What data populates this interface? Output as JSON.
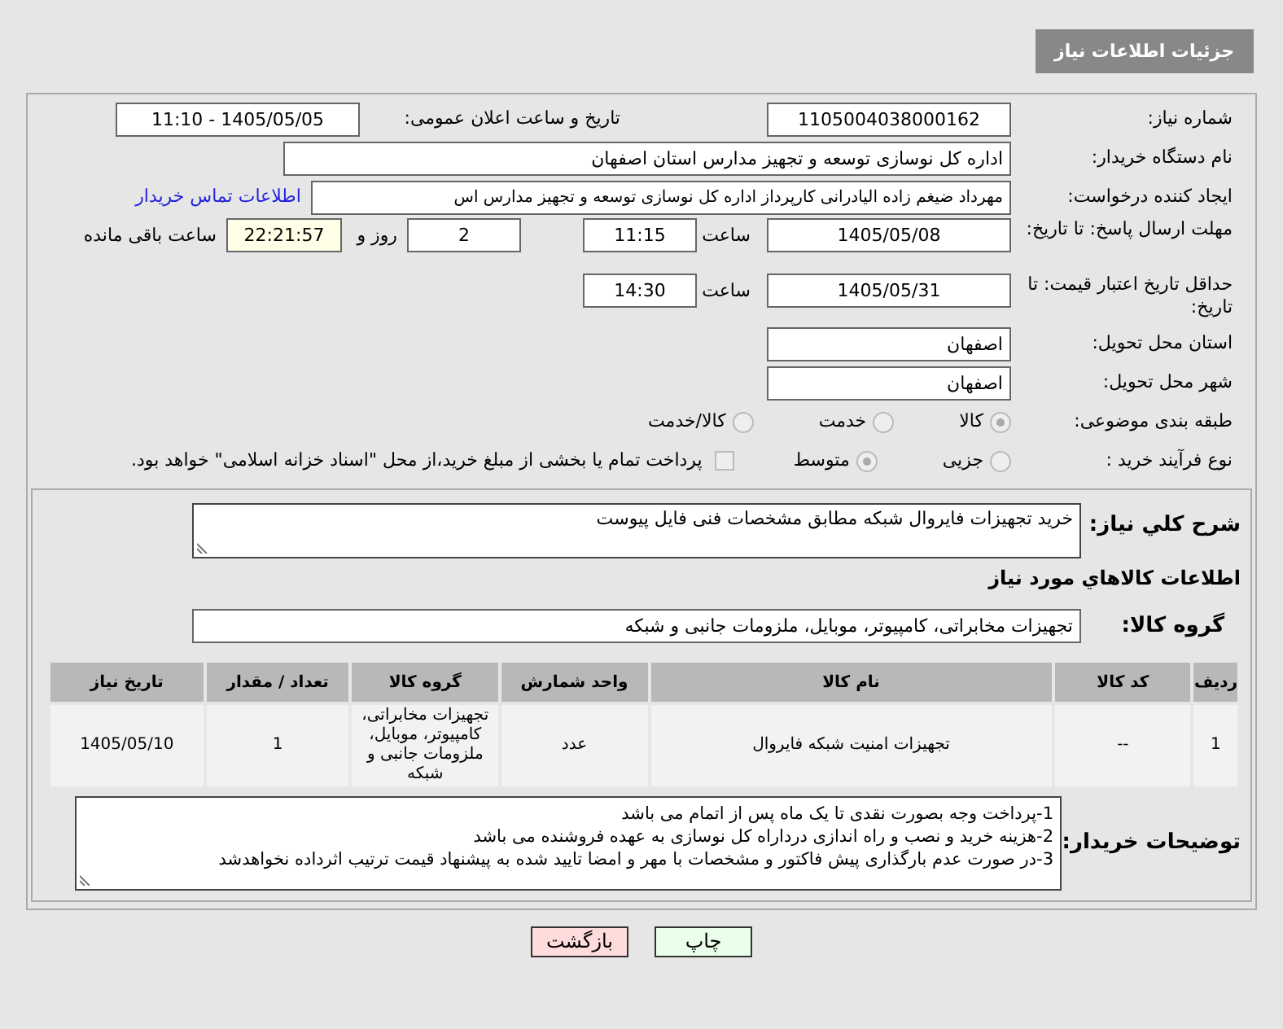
{
  "header": {
    "title": "جزئیات اطلاعات نیاز"
  },
  "need_number": {
    "label": "شماره نیاز:",
    "value": "1105004038000162"
  },
  "announce": {
    "label": "تاریخ و ساعت اعلان عمومی:",
    "value": "1405/05/05 - 11:10"
  },
  "buyer": {
    "label": "نام دستگاه خریدار:",
    "value": "اداره کل نوسازی  توسعه و تجهیز مدارس استان اصفهان"
  },
  "creator": {
    "label": "ایجاد کننده درخواست:",
    "value": "مهرداد ضیغم زاده الیادرانی کارپرداز اداره کل نوسازی  توسعه و تجهیز مدارس اس",
    "link": "اطلاعات تماس خریدار"
  },
  "deadline": {
    "label": "مهلت ارسال پاسخ: تا تاریخ:",
    "date": "1405/05/08",
    "time_label": "ساعت",
    "time": "11:15",
    "days": "2",
    "days_label": "روز و",
    "remaining": "22:21:57",
    "remaining_label": "ساعت باقی مانده"
  },
  "validity": {
    "label": "حداقل تاریخ اعتبار قیمت: تا تاریخ:",
    "date": "1405/05/31",
    "time_label": "ساعت",
    "time": "14:30"
  },
  "province": {
    "label": "استان محل تحویل:",
    "value": "اصفهان"
  },
  "city": {
    "label": "شهر محل تحویل:",
    "value": "اصفهان"
  },
  "category": {
    "label": "طبقه بندی موضوعی:",
    "options": [
      {
        "label": "کالا",
        "selected": true
      },
      {
        "label": "خدمت",
        "selected": false
      },
      {
        "label": "کالا/خدمت",
        "selected": false
      }
    ]
  },
  "process": {
    "label": "نوع فرآیند خرید :",
    "options": [
      {
        "label": "جزیی",
        "selected": false
      },
      {
        "label": "متوسط",
        "selected": true
      }
    ],
    "treasury": {
      "label": "پرداخت تمام یا بخشی از مبلغ خرید،از محل \"اسناد خزانه اسلامی\" خواهد بود.",
      "checked": false
    }
  },
  "description": {
    "label": "شرح کلي نياز:",
    "value": "خريد تجهيزات فايروال شبکه مطابق مشخصات فنی فايل پيوست"
  },
  "goods_heading": "اطلاعات کالاهاي مورد نياز",
  "goods_group": {
    "label": "گروه کالا:",
    "value": "تجهیزات مخابراتی، کامپیوتر، موبایل، ملزومات جانبی و شبکه"
  },
  "table": {
    "columns": [
      "ردیف",
      "کد کالا",
      "نام کالا",
      "واحد شمارش",
      "گروه کالا",
      "تعداد / مقدار",
      "تاریخ نیاز"
    ],
    "rows": [
      [
        "1",
        "--",
        "تجهیزات امنیت شبکه فایروال",
        "عدد",
        "تجهیزات مخابراتی، کامپیوتر، موبایل، ملزومات جانبی و شبکه",
        "1",
        "1405/05/10"
      ]
    ]
  },
  "notes": {
    "label": "توضیحات خریدار:",
    "lines": [
      "1-پرداخت وجه بصورت نقدی تا یک ماه پس از اتمام می باشد",
      "2-هزینه خرید و نصب و راه اندازی درداراه کل نوسازی به عهده فروشنده می باشد",
      "3-در صورت عدم بارگذاری پیش فاکتور و مشخصات با مهر و امضا تایید شده به پیشنهاد قیمت ترتیب اثرداده نخواهدشد"
    ]
  },
  "buttons": [
    {
      "label": "چاپ",
      "kind": "print"
    },
    {
      "label": "بازگشت",
      "kind": "back"
    }
  ]
}
